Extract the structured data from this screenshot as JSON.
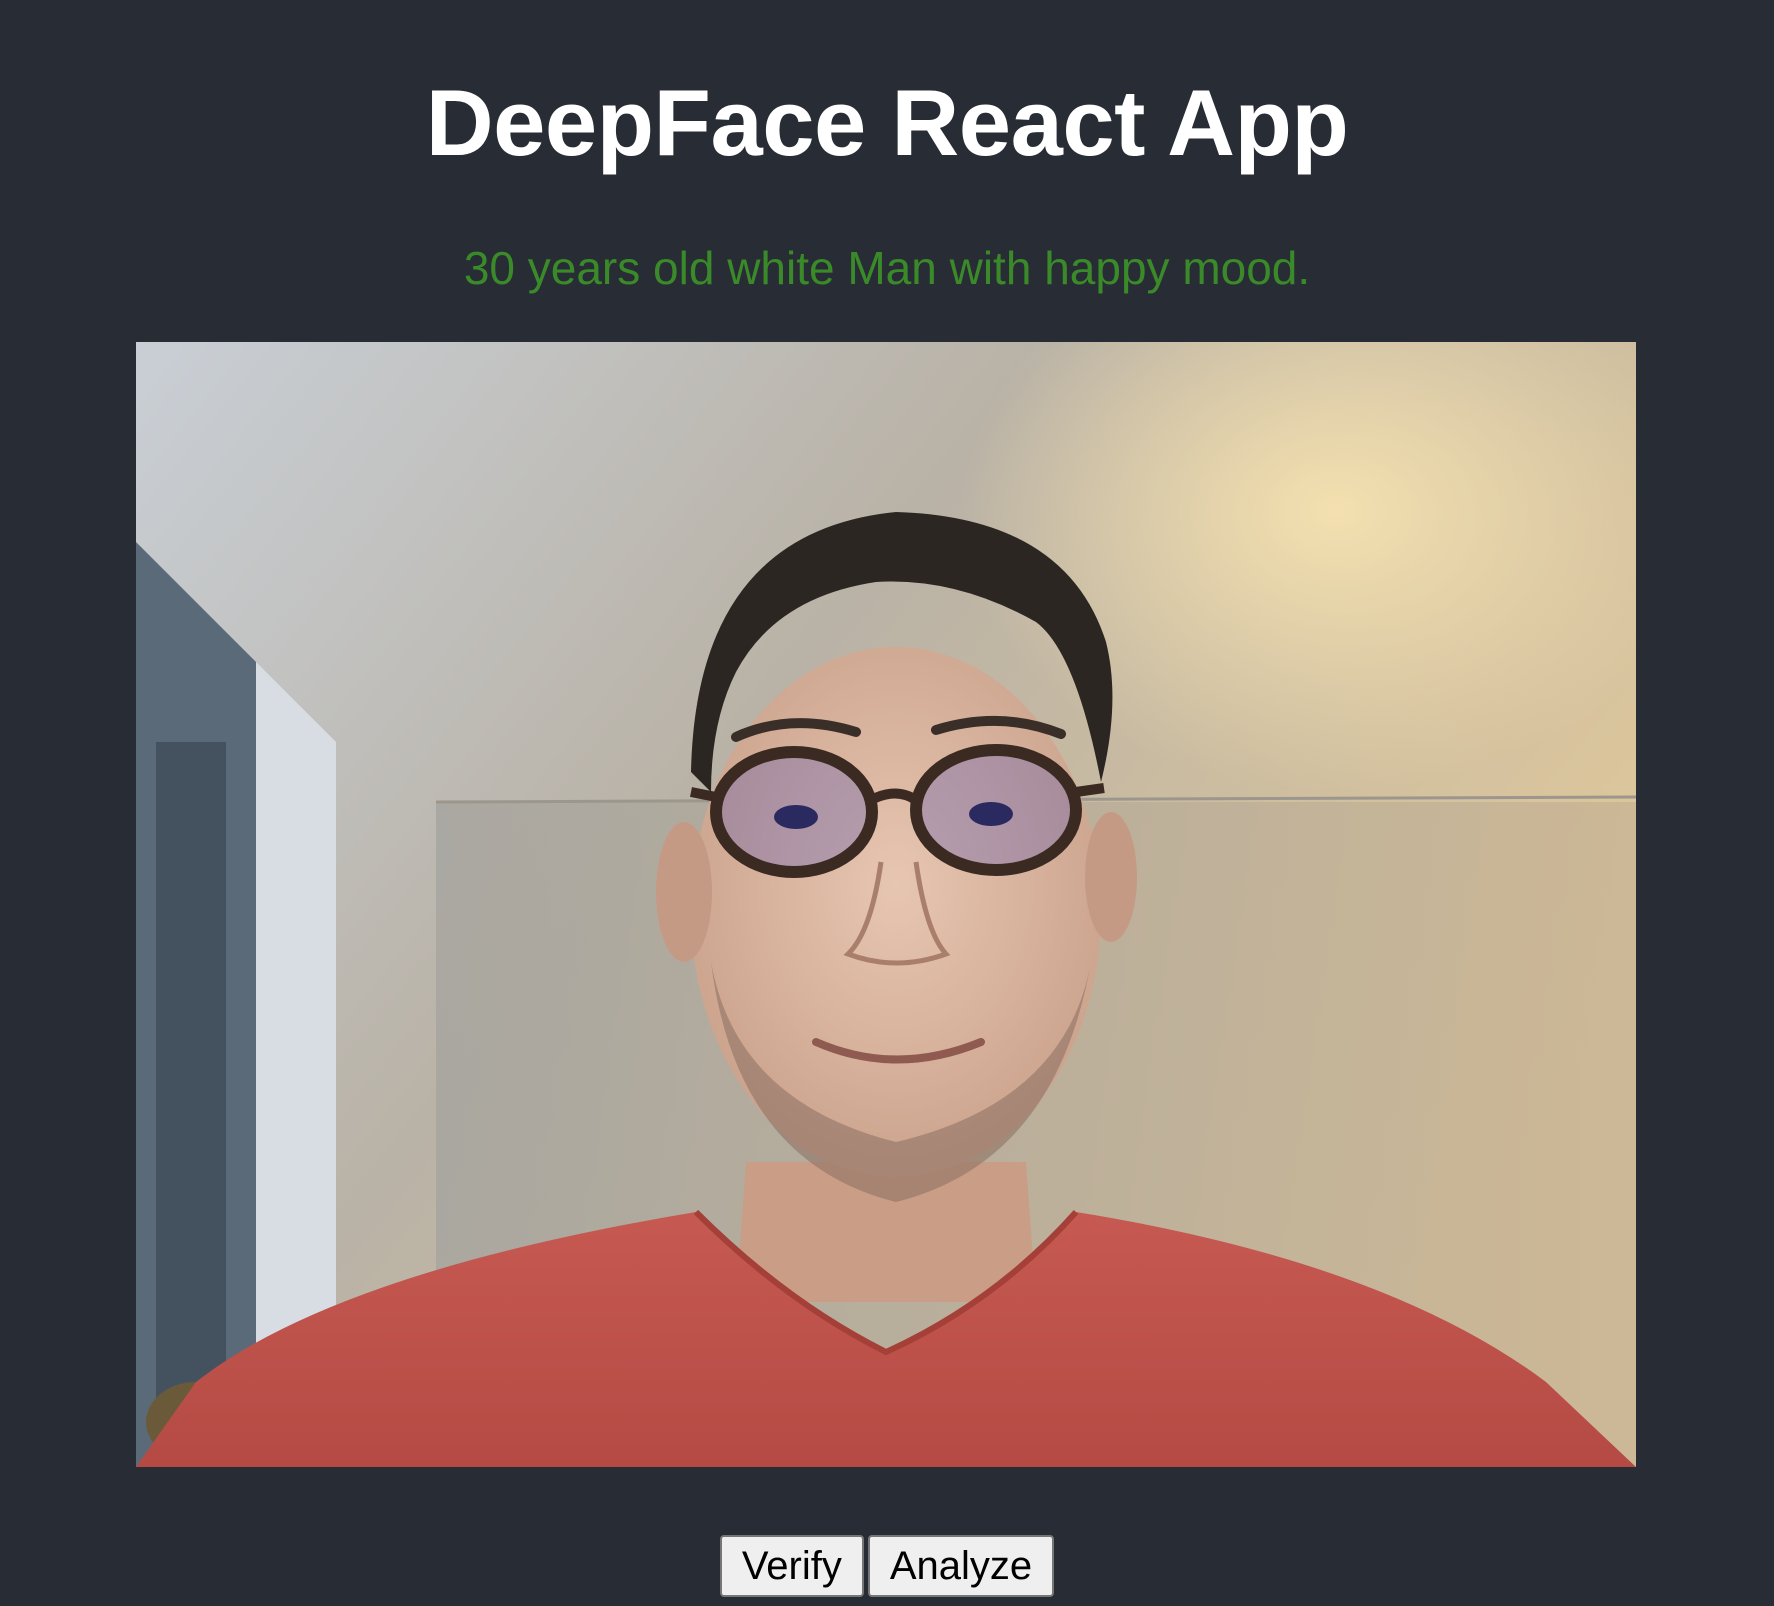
{
  "app": {
    "title": "DeepFace React App",
    "result_text": "30 years old white Man with happy mood.",
    "colors": {
      "background": "#282c34",
      "title": "#ffffff",
      "result": "#3a8a2a"
    }
  },
  "webcam": {
    "icon": "webcam-feed-image"
  },
  "buttons": {
    "verify_label": "Verify",
    "analyze_label": "Analyze"
  }
}
